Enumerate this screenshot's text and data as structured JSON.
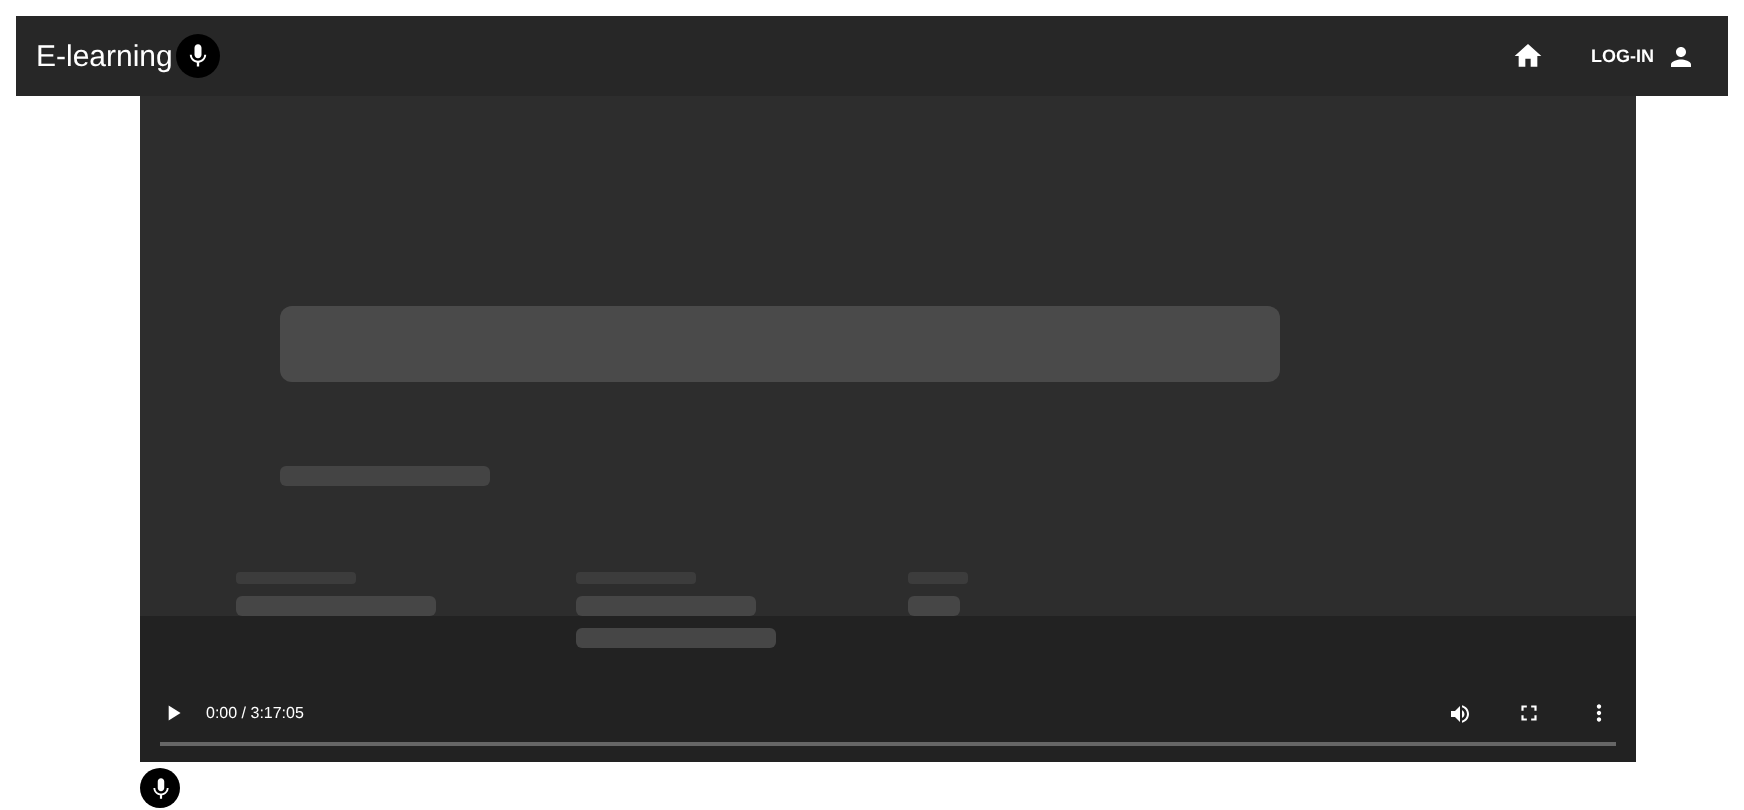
{
  "app_bar": {
    "title": "E-learning",
    "login": "LOG-IN"
  },
  "video": {
    "kind": "picture",
    "time": "0:00 / 3:17:05"
  }
}
